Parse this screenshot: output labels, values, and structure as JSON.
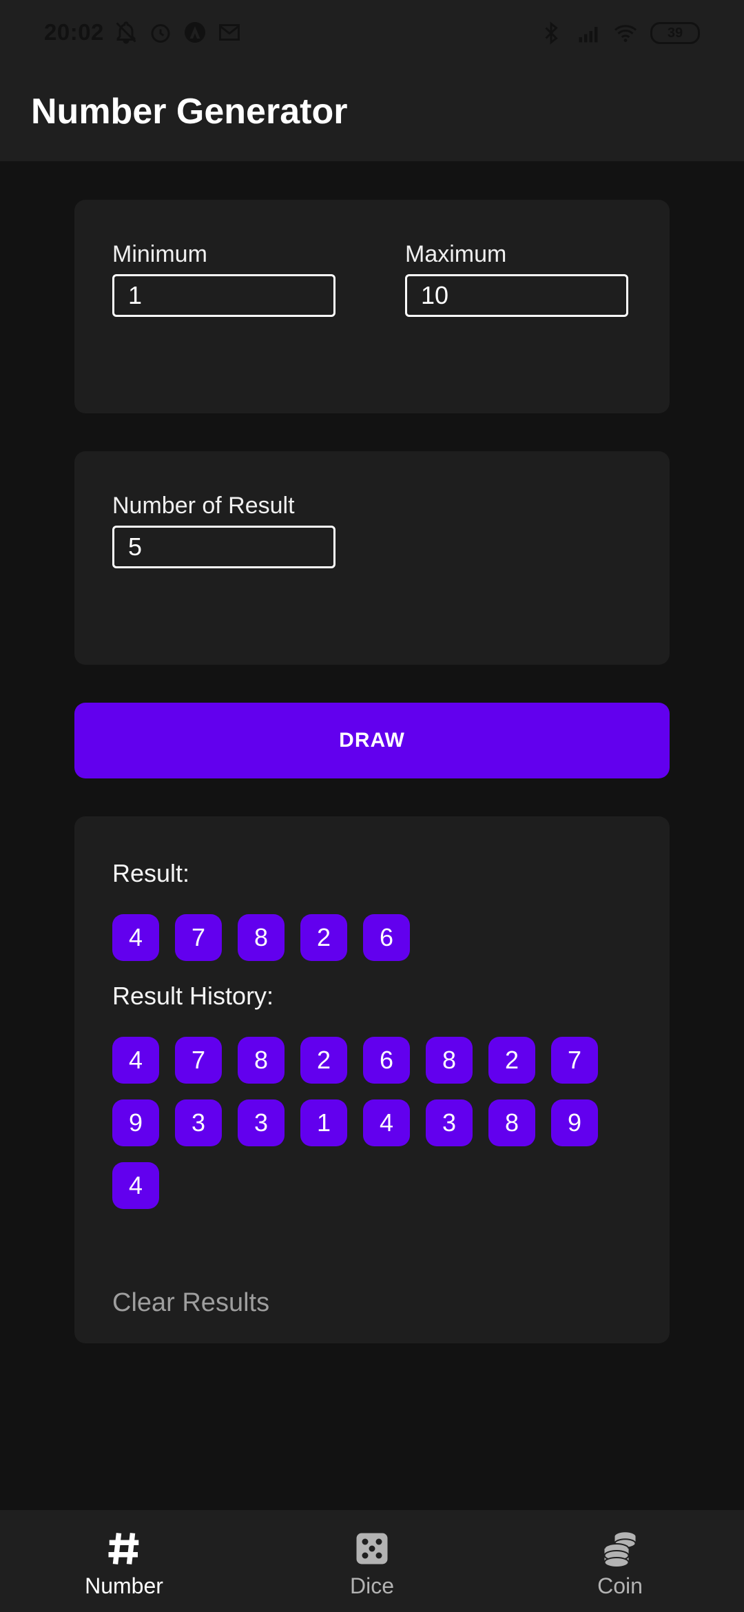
{
  "status": {
    "time": "20:02",
    "battery": "39"
  },
  "app": {
    "title": "Number Generator"
  },
  "range": {
    "min_label": "Minimum",
    "min_value": "1",
    "max_label": "Maximum",
    "max_value": "10"
  },
  "count": {
    "label": "Number of Result",
    "value": "5"
  },
  "draw": {
    "label": "DRAW"
  },
  "results": {
    "label": "Result:",
    "values": [
      "4",
      "7",
      "8",
      "2",
      "6"
    ],
    "history_label": "Result History:",
    "history": [
      "4",
      "7",
      "8",
      "2",
      "6",
      "8",
      "2",
      "7",
      "9",
      "3",
      "3",
      "1",
      "4",
      "3",
      "8",
      "9",
      "4"
    ],
    "clear_label": "Clear Results"
  },
  "nav": {
    "items": [
      {
        "label": "Number",
        "icon": "hash-icon",
        "active": true
      },
      {
        "label": "Dice",
        "icon": "dice-icon",
        "active": false
      },
      {
        "label": "Coin",
        "icon": "coins-icon",
        "active": false
      }
    ]
  },
  "colors": {
    "accent": "#6200ee",
    "background": "#121212",
    "surface": "#1e1e1e"
  }
}
